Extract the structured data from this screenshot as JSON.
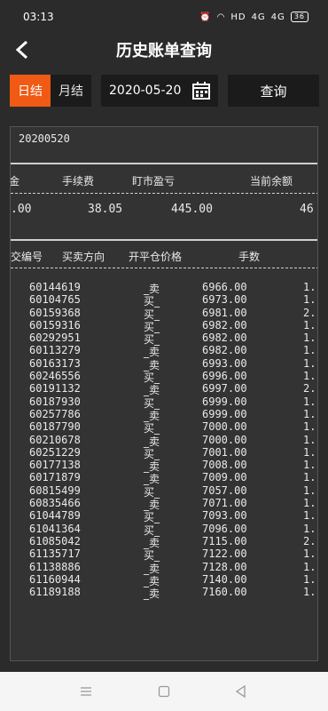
{
  "status": {
    "time": "03:13",
    "net": "HD",
    "signal1": "4G",
    "signal2": "4G",
    "battery": "36"
  },
  "header": {
    "title": "历史账单查询"
  },
  "toolbar": {
    "tab_day": "日结",
    "tab_month": "月结",
    "date_value": "2020-05-20",
    "query_label": "查询"
  },
  "panel": {
    "date": "20200520",
    "summary_headers": [
      "金",
      "手续费",
      "盯市盈亏",
      "当前余额"
    ],
    "summary_values": [
      ".00",
      "38.05",
      "445.00",
      "46"
    ],
    "column_headers": [
      "交编号",
      "买卖方向",
      "开平仓价格",
      "手数"
    ],
    "trades": [
      {
        "id": "60144619",
        "dir": "_卖",
        "price": "6966.00",
        "qty": "1."
      },
      {
        "id": "60104765",
        "dir": "买_",
        "price": "6973.00",
        "qty": "1."
      },
      {
        "id": "60159368",
        "dir": "买_",
        "price": "6981.00",
        "qty": "2."
      },
      {
        "id": "60159316",
        "dir": "买_",
        "price": "6982.00",
        "qty": "1."
      },
      {
        "id": "60292951",
        "dir": "买_",
        "price": "6982.00",
        "qty": "1."
      },
      {
        "id": "60113279",
        "dir": "_卖",
        "price": "6982.00",
        "qty": "1."
      },
      {
        "id": "60163173",
        "dir": "_卖",
        "price": "6993.00",
        "qty": "1."
      },
      {
        "id": "60246556",
        "dir": "买_",
        "price": "6996.00",
        "qty": "1."
      },
      {
        "id": "60191132",
        "dir": "_卖",
        "price": "6997.00",
        "qty": "2."
      },
      {
        "id": "60187930",
        "dir": "买_",
        "price": "6999.00",
        "qty": "1."
      },
      {
        "id": "60257786",
        "dir": "_卖",
        "price": "6999.00",
        "qty": "1."
      },
      {
        "id": "60187790",
        "dir": "买_",
        "price": "7000.00",
        "qty": "1."
      },
      {
        "id": "60210678",
        "dir": "_卖",
        "price": "7000.00",
        "qty": "1."
      },
      {
        "id": "60251229",
        "dir": "买_",
        "price": "7001.00",
        "qty": "1."
      },
      {
        "id": "60177138",
        "dir": "_卖",
        "price": "7008.00",
        "qty": "1."
      },
      {
        "id": "60171879",
        "dir": "_卖",
        "price": "7009.00",
        "qty": "1."
      },
      {
        "id": "60815499",
        "dir": "买_",
        "price": "7057.00",
        "qty": "1."
      },
      {
        "id": "60835466",
        "dir": "_卖",
        "price": "7071.00",
        "qty": "1."
      },
      {
        "id": "61044789",
        "dir": "买_",
        "price": "7093.00",
        "qty": "1."
      },
      {
        "id": "61041364",
        "dir": "买_",
        "price": "7096.00",
        "qty": "1."
      },
      {
        "id": "61085042",
        "dir": "_卖",
        "price": "7115.00",
        "qty": "2."
      },
      {
        "id": "61135717",
        "dir": "买_",
        "price": "7122.00",
        "qty": "1."
      },
      {
        "id": "61138886",
        "dir": "_卖",
        "price": "7128.00",
        "qty": "1."
      },
      {
        "id": "61160944",
        "dir": "_卖",
        "price": "7140.00",
        "qty": "1."
      },
      {
        "id": "61189188",
        "dir": "_卖",
        "price": "7160.00",
        "qty": "1."
      }
    ]
  },
  "colors": {
    "accent": "#f05a14",
    "background": "#2b2b2b",
    "panel": "#333333"
  }
}
